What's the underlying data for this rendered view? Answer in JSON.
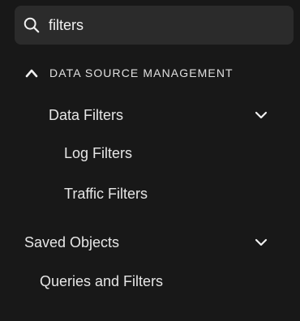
{
  "search": {
    "value": "filters",
    "icon": "search-icon"
  },
  "nav": {
    "section": {
      "title": "DATA SOURCE MANAGEMENT",
      "icon": "chevron-up-icon",
      "expanded": true
    },
    "data_filters": {
      "label": "Data Filters",
      "icon": "chevron-down-icon",
      "children": [
        {
          "label": "Log Filters"
        },
        {
          "label": "Traffic Filters"
        }
      ]
    },
    "saved_objects": {
      "label": "Saved Objects",
      "icon": "chevron-down-icon",
      "children": [
        {
          "label": "Queries and Filters"
        }
      ]
    }
  },
  "colors": {
    "background": "#181818",
    "search_background": "#2b2b2b",
    "text": "#e6e6e6"
  }
}
